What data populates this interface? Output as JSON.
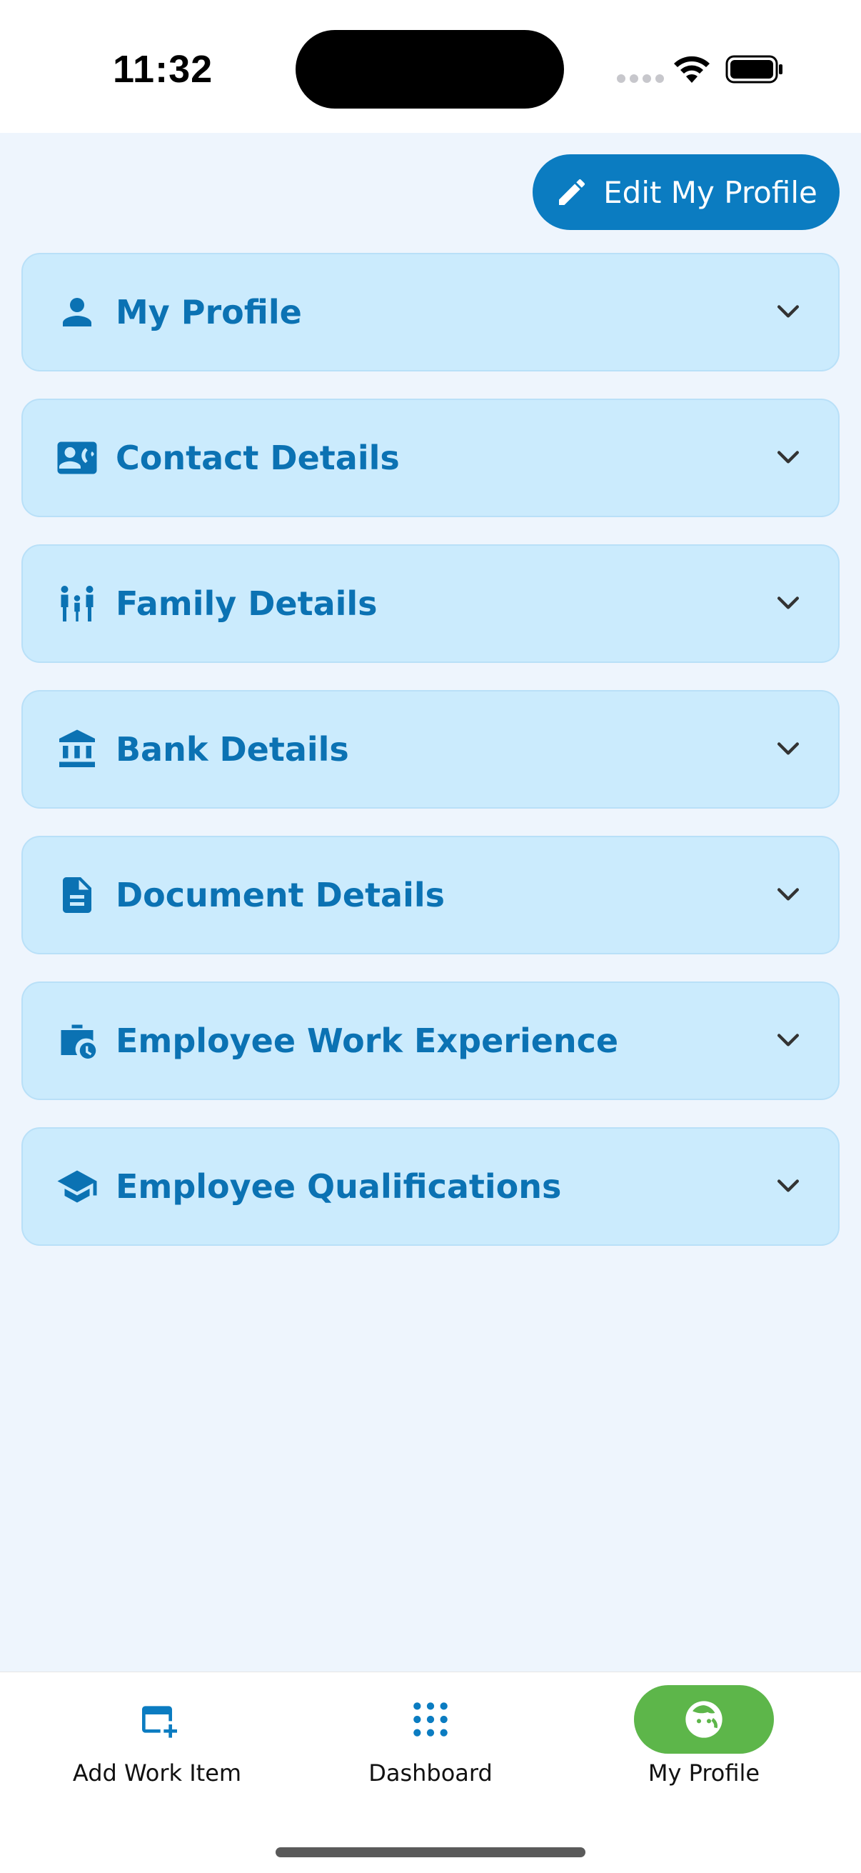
{
  "status_bar": {
    "time": "11:32"
  },
  "header": {
    "edit_button_label": "Edit My Profile",
    "edit_icon": "pencil-icon"
  },
  "sections": [
    {
      "label": "My Profile",
      "icon": "person-icon"
    },
    {
      "label": "Contact Details",
      "icon": "contact-card-icon"
    },
    {
      "label": "Family Details",
      "icon": "family-icon"
    },
    {
      "label": "Bank Details",
      "icon": "bank-icon"
    },
    {
      "label": "Document Details",
      "icon": "document-icon"
    },
    {
      "label": "Employee Work Experience",
      "icon": "work-history-icon"
    },
    {
      "label": "Employee Qualifications",
      "icon": "graduation-cap-icon"
    }
  ],
  "bottom_nav": {
    "items": [
      {
        "label": "Add Work Item",
        "icon": "calendar-add-icon",
        "active": false
      },
      {
        "label": "Dashboard",
        "icon": "apps-grid-icon",
        "active": false
      },
      {
        "label": "My Profile",
        "icon": "face-icon",
        "active": true
      }
    ]
  },
  "colors": {
    "primary": "#0b7cc1",
    "section_bg": "#cbebfd",
    "content_bg": "#eef5fd",
    "active_nav": "#5db64a"
  }
}
